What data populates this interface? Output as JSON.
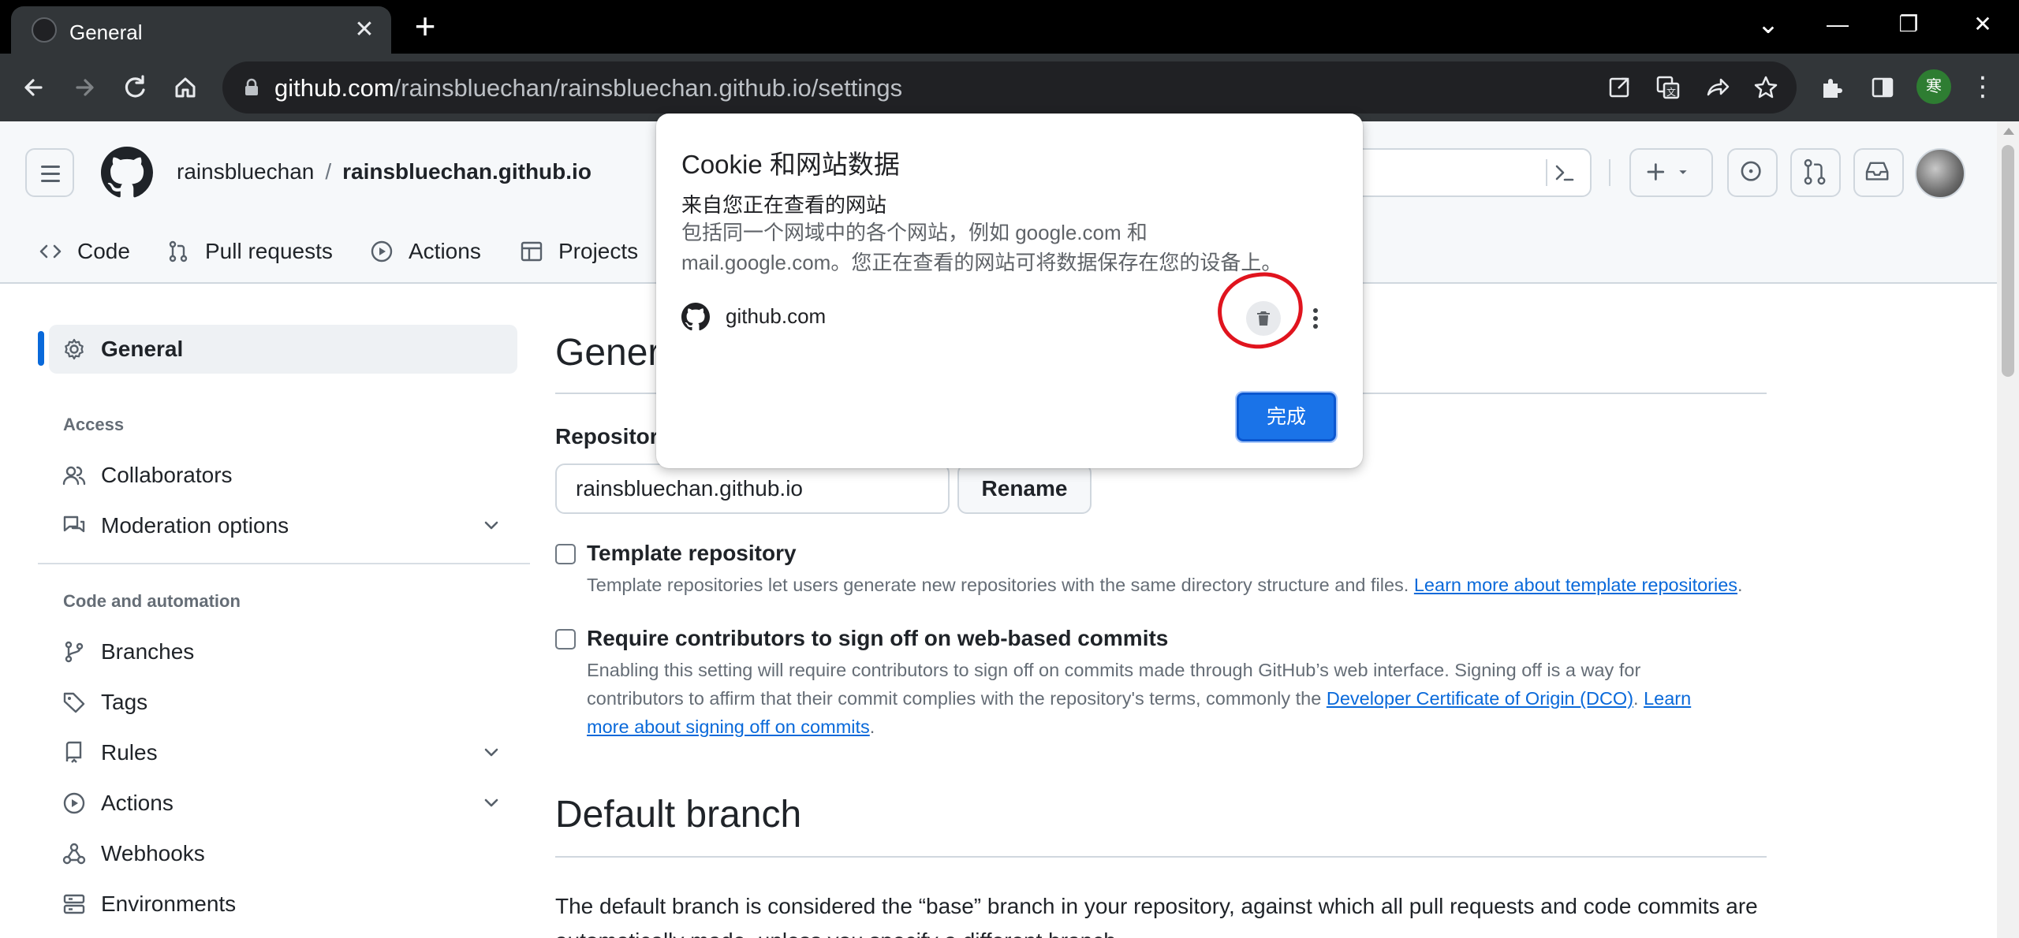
{
  "browser": {
    "tab_title": "General",
    "tab_close_glyph": "✕",
    "new_tab_glyph": "+",
    "url_host": "github.com",
    "url_path": "/rainsbluechan/rainsbluechan.github.io/settings",
    "profile_initial": "寒",
    "window_controls": {
      "dropdown": "⌄",
      "minimize": "—",
      "restore": "❐",
      "close": "✕"
    },
    "menu_glyph": "⋮"
  },
  "github": {
    "owner": "rainsbluechan",
    "separator": "/",
    "repo": "rainsbluechan.github.io",
    "nav_tabs": [
      {
        "label": "Code",
        "icon": "code-icon"
      },
      {
        "label": "Pull requests",
        "icon": "git-pull-request-icon"
      },
      {
        "label": "Actions",
        "icon": "play-icon"
      },
      {
        "label": "Projects",
        "icon": "table-icon"
      }
    ]
  },
  "sidebar": {
    "general": "General",
    "access_heading": "Access",
    "collaborators": "Collaborators",
    "moderation": "Moderation options",
    "code_heading": "Code and automation",
    "branches": "Branches",
    "tags": "Tags",
    "rules": "Rules",
    "actions": "Actions",
    "webhooks": "Webhooks",
    "environments": "Environments"
  },
  "main": {
    "title_visible": "Gener",
    "repo_name_label_visible": "Repository",
    "repo_name_value": "rainsbluechan.github.io",
    "rename_label": "Rename",
    "template": {
      "title": "Template repository",
      "desc": "Template repositories let users generate new repositories with the same directory structure and files. ",
      "link": "Learn more about template repositories",
      "after": "."
    },
    "signoff": {
      "title": "Require contributors to sign off on web-based commits",
      "line1": "Enabling this setting will require contributors to sign off on commits made through GitHub’s web interface. Signing off is a way for",
      "line2_text": "contributors to affirm that their commit complies with the repository's terms, commonly the ",
      "line2_link1": "Developer Certificate of Origin (DCO)",
      "line2_sep": ". ",
      "line2_link2": "Learn",
      "line3_link": "more about signing off on commits",
      "line3_after": "."
    },
    "default_branch_title": "Default branch",
    "default_branch_desc_line1": "The default branch is considered the “base” branch in your repository, against which all pull requests and code commits are",
    "default_branch_desc_line2": "automatically made, unless you specify a different branch."
  },
  "cookie_popup": {
    "title": "Cookie 和网站数据",
    "subtitle": "来自您正在查看的网站",
    "desc_line1": "包括同一个网域中的各个网站，例如 google.com 和",
    "desc_line2": "mail.google.com。您正在查看的网站可将数据保存在您的设备上。",
    "site": "github.com",
    "done_label": "完成",
    "annotation_color": "#e0141e"
  },
  "colors": {
    "chrome_dark": "#323639",
    "omnibox": "#202124",
    "accent_blue": "#1a73e8",
    "link_blue": "#0969da",
    "border": "#d0d7de"
  }
}
